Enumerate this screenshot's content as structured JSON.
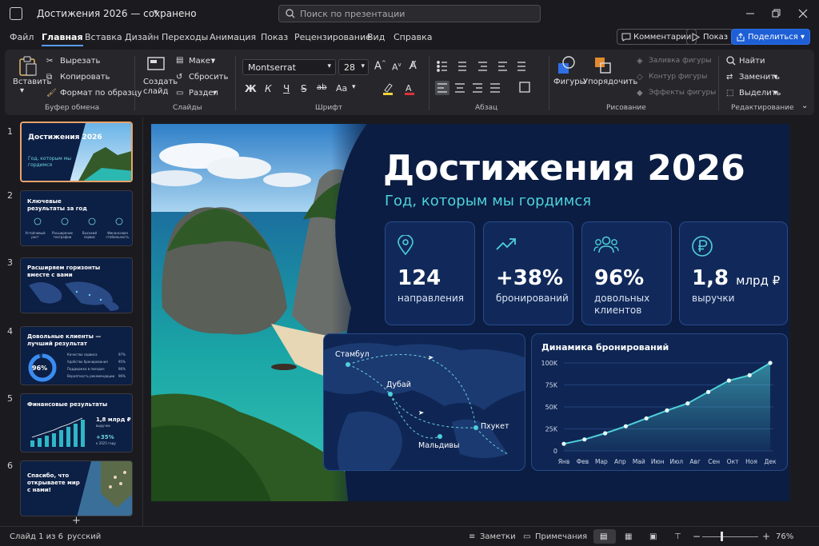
{
  "window": {
    "title": "Достижения 2026 — сохранено",
    "search_placeholder": "Поиск по презентации"
  },
  "menu": [
    "Файл",
    "Главная",
    "Вставка",
    "Дизайн",
    "Переходы",
    "Анимация",
    "Показ",
    "Рецензирование",
    "Вид",
    "Справка"
  ],
  "top_buttons": {
    "comments": "Комментарии",
    "show": "Показ",
    "share": "Поделиться"
  },
  "ribbon": {
    "clipboard": {
      "paste": "Вставить",
      "cut": "Вырезать",
      "copy": "Копировать",
      "format_painter": "Формат по образцу",
      "group": "Буфер обмена"
    },
    "slides": {
      "new_slide": "Создать слайд",
      "layout": "Макет",
      "reset": "Сбросить",
      "section": "Раздел",
      "group": "Слайды"
    },
    "font": {
      "family": "Montserrat",
      "size": "28",
      "group": "Шрифт",
      "bold": "Ж",
      "italic": "К",
      "underline": "Ч",
      "strike": "S",
      "strike2": "ab",
      "case": "Aa"
    },
    "paragraph": {
      "group": "Абзац"
    },
    "drawing": {
      "shapes": "Фигуры",
      "arrange": "Упорядочить",
      "fill": "Заливка фигуры",
      "outline": "Контур фигуры",
      "effects": "Эффекты фигуры",
      "group": "Рисование"
    },
    "editing": {
      "find": "Найти",
      "replace": "Заменить",
      "select": "Выделить",
      "group": "Редактирование"
    }
  },
  "thumbnails": [
    {
      "num": "1",
      "title": "Достижения 2026",
      "subtitle": "Год, которым мы гордимся"
    },
    {
      "num": "2",
      "title": "Ключевые результаты за год",
      "items": [
        "Устойчивый рост",
        "Расширение географии",
        "Высокий сервис",
        "Финансовая стабильность"
      ]
    },
    {
      "num": "3",
      "title": "Расширяем горизонты вместе с вами"
    },
    {
      "num": "4",
      "title": "Довольные клиенты — лучший результат",
      "pct": "96%",
      "rows": [
        [
          "Качество сервиса",
          "97%"
        ],
        [
          "Удобство бронирования",
          "95%"
        ],
        [
          "Поддержка в поездке",
          "96%"
        ],
        [
          "Вероятность рекомендации",
          "96%"
        ]
      ]
    },
    {
      "num": "5",
      "title": "Финансовые результаты",
      "value": "1,8 млрд ₽",
      "value_sub": "выручки",
      "growth": "+35%",
      "growth_sub": "к 2025 году"
    },
    {
      "num": "6",
      "title": "Спасибо, что открываете мир с нами!"
    }
  ],
  "slide": {
    "title": "Достижения 2026",
    "subtitle": "Год, которым мы гордимся",
    "cards": [
      {
        "icon": "location-pin-icon",
        "value": "124",
        "label": "направления"
      },
      {
        "icon": "trend-up-icon",
        "value": "+38%",
        "label": "бронирований"
      },
      {
        "icon": "users-icon",
        "value": "96%",
        "label": "довольных клиентов"
      },
      {
        "icon": "ruble-icon",
        "value": "1,8",
        "unit": "млрд ₽",
        "label": "выручки"
      }
    ],
    "map": {
      "cities": [
        "Стамбул",
        "Дубай",
        "Пхукет",
        "Мальдивы"
      ]
    },
    "chart_title": "Динамика бронирований"
  },
  "chart_data": {
    "type": "area",
    "title": "Динамика бронирований",
    "categories": [
      "Янв",
      "Фев",
      "Мар",
      "Апр",
      "Май",
      "Июн",
      "Июл",
      "Авг",
      "Сен",
      "Окт",
      "Ноя",
      "Дек"
    ],
    "series": [
      {
        "values": [
          8,
          12,
          20,
          29,
          38,
          46,
          54,
          67,
          80,
          85,
          100
        ]
      }
    ],
    "values": [
      8,
      13,
      20,
      28,
      37,
      46,
      54,
      67,
      80,
      86,
      100
    ],
    "yticks": [
      "0",
      "25K",
      "50K",
      "75K",
      "100K"
    ],
    "ylim": [
      0,
      100
    ],
    "ylabel_unit": "K",
    "grid": true,
    "accent": "#4fd1d9"
  },
  "status": {
    "slide": "Слайд 1 из 6",
    "lang": "русский",
    "notes": "Заметки",
    "comments": "Примечания",
    "zoom": "76%",
    "minus": "−",
    "plus": "+"
  }
}
